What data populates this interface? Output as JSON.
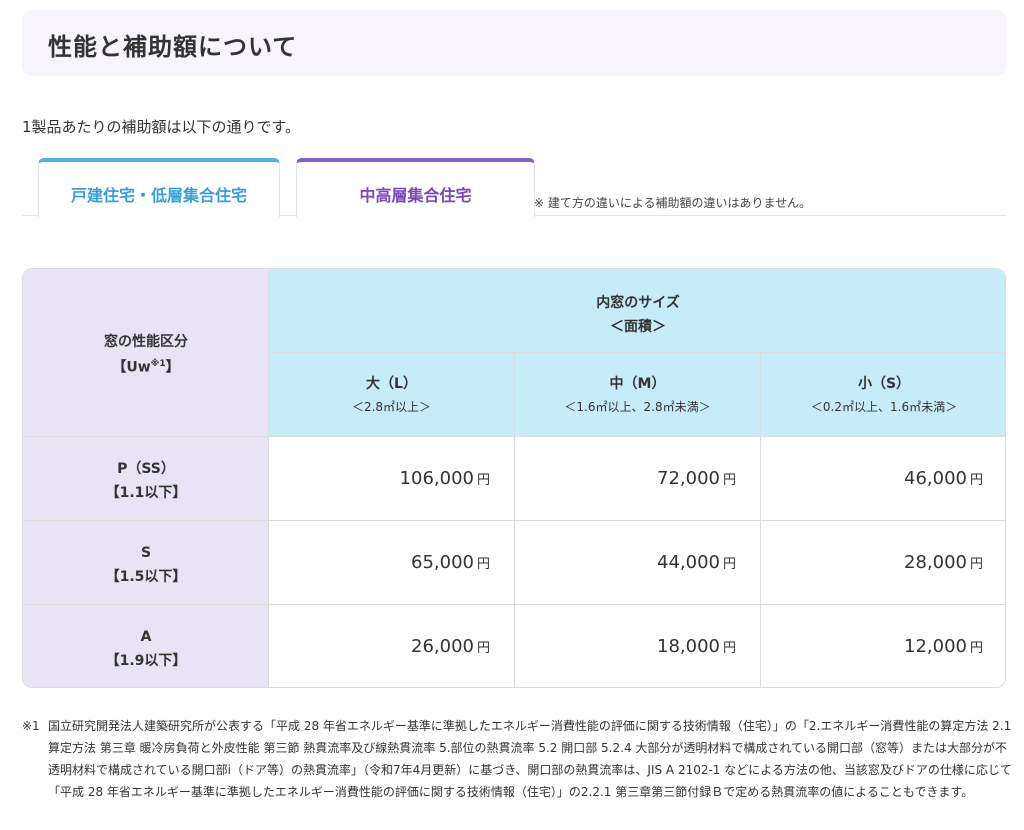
{
  "header": {
    "title": "性能と補助額について"
  },
  "intro": "1製品あたりの補助額は以下の通りです。",
  "tabs": [
    {
      "label": "戸建住宅・低層集合住宅",
      "color": "#4fb3e6"
    },
    {
      "label": "中高層集合住宅",
      "color": "#8a5cc9"
    }
  ],
  "tab_note": "※ 建て方の違いによる補助額の違いはありません。",
  "table": {
    "corner": {
      "line1": "窓の性能区分",
      "line2_prefix": "【Uw",
      "line2_sup": "※1",
      "line2_suffix": "】"
    },
    "size_header": {
      "title": "内窓のサイズ",
      "subtitle": "＜面積＞"
    },
    "size_columns": [
      {
        "label": "大（L）",
        "range": "＜2.8㎡以上＞"
      },
      {
        "label": "中（M）",
        "range": "＜1.6㎡以上、2.8㎡未満＞"
      },
      {
        "label": "小（S）",
        "range": "＜0.2㎡以上、1.6㎡未満＞"
      }
    ],
    "rows": [
      {
        "grade": "P（SS）",
        "uw": "【1.1以下】",
        "values": [
          "106,000",
          "72,000",
          "46,000"
        ]
      },
      {
        "grade": "S",
        "uw": "【1.5以下】",
        "values": [
          "65,000",
          "44,000",
          "28,000"
        ]
      },
      {
        "grade": "A",
        "uw": "【1.9以下】",
        "values": [
          "26,000",
          "18,000",
          "12,000"
        ]
      }
    ],
    "currency": "円"
  },
  "footnote": {
    "mark": "※1",
    "text": "国立研究開発法人建築研究所が公表する「平成 28 年省エネルギー基準に準拠したエネルギー消費性能の評価に関する技術情報（住宅）」の「2.エネルギー消費性能の算定方法 2.1 算定方法 第三章 暖冷房負荷と外皮性能 第三節 熱貫流率及び線熱貫流率 5.部位の熱貫流率 5.2 開口部 5.2.4 大部分が透明材料で構成されている開口部（窓等）または大部分が不透明材料で構成されている開口部i（ドア等）の熱貫流率」（令和7年4月更新）に基づき、開口部の熱貫流率は、JIS A 2102-1 などによる方法の他、当該窓及びドアの仕様に応じて「平成 28 年省エネルギー基準に準拠したエネルギー消費性能の評価に関する技術情報（住宅）」の2.2.1 第三章第三節付録Ｂで定める熱貫流率の値によることもできます。"
  }
}
